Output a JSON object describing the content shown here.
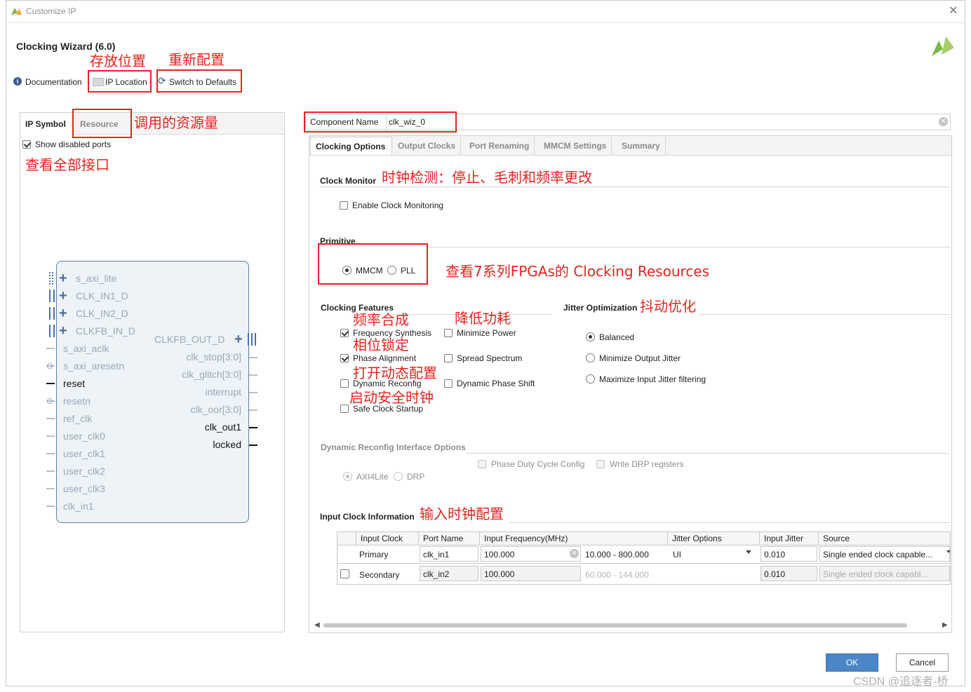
{
  "window": {
    "title": "Customize IP"
  },
  "header": {
    "title": "Clocking Wizard (6.0)",
    "documentation": "Documentation",
    "ip_location": "IP Location",
    "switch_defaults": "Switch to Defaults"
  },
  "left": {
    "tabs": [
      "IP Symbol",
      "Resource"
    ],
    "show_disabled": "Show disabled ports",
    "left_ports": [
      "s_axi_lite",
      "CLK_IN1_D",
      "CLK_IN2_D",
      "CLKFB_IN_D",
      "s_axi_aclk",
      "s_axi_aresetn",
      "reset",
      "resetn",
      "ref_clk",
      "user_clk0",
      "user_clk1",
      "user_clk2",
      "user_clk3",
      "clk_in1"
    ],
    "right_ports": [
      "CLKFB_OUT_D",
      "clk_stop[3:0]",
      "clk_glitch[3:0]",
      "interrupt",
      "clk_oor[3:0]",
      "clk_out1",
      "locked"
    ]
  },
  "component": {
    "label": "Component Name",
    "value": "clk_wiz_0"
  },
  "tabs": [
    "Clocking Options",
    "Output Clocks",
    "Port Renaming",
    "MMCM Settings",
    "Summary"
  ],
  "clock_monitor": {
    "title": "Clock Monitor",
    "enable": "Enable Clock Monitoring"
  },
  "primitive": {
    "title": "Primitive",
    "mmcm": "MMCM",
    "pll": "PLL"
  },
  "features": {
    "title": "Clocking Features",
    "freq_synth": "Frequency Synthesis",
    "min_power": "Minimize Power",
    "phase_align": "Phase Alignment",
    "spread": "Spread Spectrum",
    "dyn_reconfig": "Dynamic Reconfig",
    "dyn_phase": "Dynamic Phase Shift",
    "safe_start": "Safe Clock Startup"
  },
  "jitter": {
    "title": "Jitter Optimization",
    "balanced": "Balanced",
    "min_out": "Minimize Output Jitter",
    "max_in": "Maximize Input Jitter filtering"
  },
  "drp": {
    "title": "Dynamic Reconfig Interface Options",
    "phase_duty": "Phase Duty Cycle Config",
    "write_drp": "Write DRP registers",
    "axi4lite": "AXI4Lite",
    "drp": "DRP"
  },
  "input_clock": {
    "title": "Input Clock Information",
    "headers": [
      "Input Clock",
      "Port Name",
      "Input Frequency(MHz)",
      "Jitter Options",
      "Input Jitter",
      "Source"
    ],
    "primary": {
      "name": "Primary",
      "port": "clk_in1",
      "freq": "100.000",
      "range": "10.000 - 800.000",
      "jitter_opt": "UI",
      "jitter": "0.010",
      "source": "Single ended clock capable..."
    },
    "secondary": {
      "name": "Secondary",
      "port": "clk_in2",
      "freq": "100.000",
      "range": "60.000 - 144.000",
      "jitter": "0.010",
      "source": "Single ended clock capabl..."
    }
  },
  "buttons": {
    "ok": "OK",
    "cancel": "Cancel"
  },
  "annotations": {
    "location": "存放位置",
    "reconfig": "重新配置",
    "resource": "调用的资源量",
    "all_ports": "查看全部接口",
    "monitor": "时钟检测：停止、毛刺和频率更改",
    "clocking_res": "查看7系列FPGAs的  Clocking Resources",
    "freq": "频率合成",
    "power": "降低功耗",
    "phase": "相位锁定",
    "dynamic": "打开动态配置",
    "safe": "启动安全时钟",
    "jitter": "抖动优化",
    "input": "输入时钟配置"
  },
  "watermark": "CSDN @追逐者-桥",
  "colors": {
    "accent": "#e8231d",
    "ok_button": "#4a86c8",
    "block_fill": "#eef3f8",
    "block_border": "#5d7ea4"
  }
}
